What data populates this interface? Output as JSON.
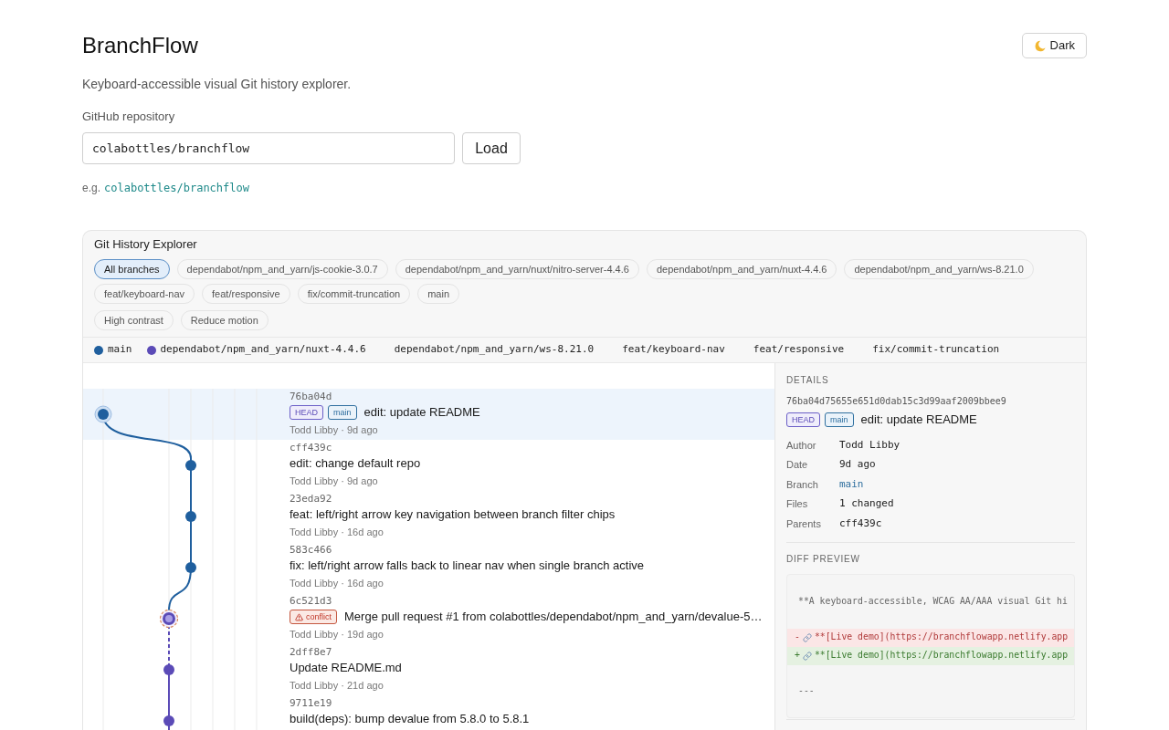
{
  "header": {
    "title": "BranchFlow",
    "theme_button": {
      "label": "Dark"
    },
    "subtitle": "Keyboard-accessible visual Git history explorer."
  },
  "repo_form": {
    "label": "GitHub repository",
    "value": "colabottles/branchflow",
    "button": "Load",
    "example_prefix": "e.g.",
    "example_link": "colabottles/branchflow"
  },
  "explorer": {
    "title": "Git History Explorer",
    "branch_filters": [
      {
        "label": "All branches",
        "selected": true
      },
      {
        "label": "dependabot/npm_and_yarn/js-cookie-3.0.7",
        "selected": false
      },
      {
        "label": "dependabot/npm_and_yarn/nuxt/nitro-server-4.4.6",
        "selected": false
      },
      {
        "label": "dependabot/npm_and_yarn/nuxt-4.4.6",
        "selected": false
      },
      {
        "label": "dependabot/npm_and_yarn/ws-8.21.0",
        "selected": false
      },
      {
        "label": "feat/keyboard-nav",
        "selected": false
      },
      {
        "label": "feat/responsive",
        "selected": false
      },
      {
        "label": "fix/commit-truncation",
        "selected": false
      },
      {
        "label": "main",
        "selected": false
      }
    ],
    "toggles": [
      {
        "label": "High contrast",
        "on": false
      },
      {
        "label": "Reduce motion",
        "on": false
      }
    ],
    "legend": [
      {
        "name": "main",
        "color": "#1f5f9e"
      },
      {
        "name": "dependabot/npm_and_yarn/nuxt-4.4.6",
        "color": "#5b4bb7"
      },
      {
        "name": "dependabot/npm_and_yarn/ws-8.21.0"
      },
      {
        "name": "feat/keyboard-nav"
      },
      {
        "name": "feat/responsive"
      },
      {
        "name": "fix/commit-truncation"
      }
    ],
    "commits": [
      {
        "hash": "76ba04d",
        "badges": [
          {
            "kind": "head",
            "label": "HEAD"
          },
          {
            "kind": "branch",
            "label": "main"
          }
        ],
        "message": "edit: update README",
        "meta": "Todd Libby · 9d ago",
        "selected": true,
        "conflict": false,
        "color": "#1f5f9e"
      },
      {
        "hash": "cff439c",
        "message": "edit: change default repo",
        "meta": "Todd Libby · 9d ago",
        "selected": false,
        "conflict": false,
        "color": "#1f5f9e"
      },
      {
        "hash": "23eda92",
        "message": "feat: left/right arrow key navigation between branch filter chips",
        "meta": "Todd Libby · 16d ago",
        "selected": false,
        "conflict": false,
        "color": "#1f5f9e"
      },
      {
        "hash": "583c466",
        "message": "fix: left/right arrow falls back to linear nav when single branch active",
        "meta": "Todd Libby · 16d ago",
        "selected": false,
        "conflict": false,
        "color": "#1f5f9e"
      },
      {
        "hash": "6c521d3",
        "badges": [
          {
            "kind": "conflict",
            "label": "conflict"
          }
        ],
        "message": "Merge pull request #1 from colabottles/dependabot/npm_and_yarn/devalue-5…",
        "meta": "Todd Libby · 19d ago",
        "selected": false,
        "conflict": true,
        "color": "#5b4bb7"
      },
      {
        "hash": "2dff8e7",
        "message": "Update README.md",
        "meta": "Todd Libby · 21d ago",
        "selected": false,
        "conflict": false,
        "color": "#5b4bb7"
      },
      {
        "hash": "9711e19",
        "message": "build(deps): bump devalue from 5.8.0 to 5.8.1",
        "selected": false,
        "conflict": false,
        "color": "#5b4bb7"
      }
    ],
    "details": {
      "heading": "DETAILS",
      "hash": "76ba04d75655e651d0dab15c3d99aaf2009bbee9",
      "badges": [
        {
          "kind": "head",
          "label": "HEAD"
        },
        {
          "kind": "branch",
          "label": "main"
        }
      ],
      "message": "edit: update README",
      "fields": [
        {
          "label": "Author",
          "value": "Todd Libby",
          "kind": "text"
        },
        {
          "label": "Date",
          "value": "9d ago",
          "kind": "text"
        },
        {
          "label": "Branch",
          "value": "main",
          "kind": "link"
        },
        {
          "label": "Files",
          "value": "1 changed",
          "kind": "text"
        },
        {
          "label": "Parents",
          "value": "cff439c",
          "kind": "text"
        }
      ],
      "diff": {
        "heading": "DIFF PREVIEW",
        "lines": [
          {
            "kind": "context",
            "text": "**A keyboard-accessible, WCAG AA/AAA visual Git hi"
          },
          {
            "kind": "removed",
            "sign": "-",
            "text": "**[Live demo](https://branchflowapp.netlify.app"
          },
          {
            "kind": "added",
            "sign": "+",
            "text": "**[Live demo](https://branchflowapp.netlify.app"
          },
          {
            "kind": "context",
            "text": "---"
          }
        ]
      }
    }
  }
}
